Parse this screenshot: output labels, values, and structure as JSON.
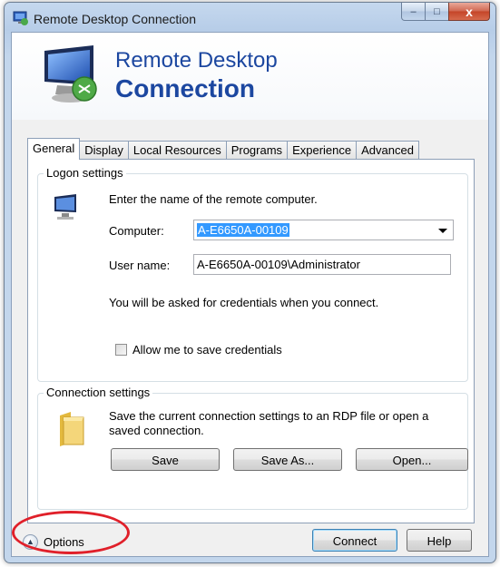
{
  "window": {
    "title": "Remote Desktop Connection",
    "buttons": {
      "minimize": "–",
      "maximize": "□",
      "close": "x"
    }
  },
  "banner": {
    "line1": "Remote Desktop",
    "line2": "Connection"
  },
  "tabs": [
    {
      "label": "General",
      "active": true
    },
    {
      "label": "Display",
      "active": false
    },
    {
      "label": "Local Resources",
      "active": false
    },
    {
      "label": "Programs",
      "active": false
    },
    {
      "label": "Experience",
      "active": false
    },
    {
      "label": "Advanced",
      "active": false
    }
  ],
  "logon": {
    "group_label": "Logon settings",
    "instruction": "Enter the name of the remote computer.",
    "computer_label": "Computer:",
    "computer_value": "A-E6650A-00109",
    "username_label": "User name:",
    "username_value": "A-E6650A-00109\\Administrator",
    "credentials_note": "You will be asked for credentials when you connect.",
    "save_credentials_label": "Allow me to save credentials",
    "save_credentials_checked": false
  },
  "connection": {
    "group_label": "Connection settings",
    "description_line1": "Save the current connection settings to an RDP file or open a",
    "description_line2": "saved connection.",
    "save_label": "Save",
    "save_as_label": "Save As...",
    "open_label": "Open..."
  },
  "footer": {
    "options_label": "Options",
    "connect_label": "Connect",
    "help_label": "Help"
  },
  "colors": {
    "banner_text": "#1c47a0",
    "selection": "#3399ff",
    "highlight_oval": "#e0202a"
  },
  "icons": [
    "rdc-icon",
    "computer-icon",
    "folder-icon",
    "chevron-up-icon"
  ]
}
